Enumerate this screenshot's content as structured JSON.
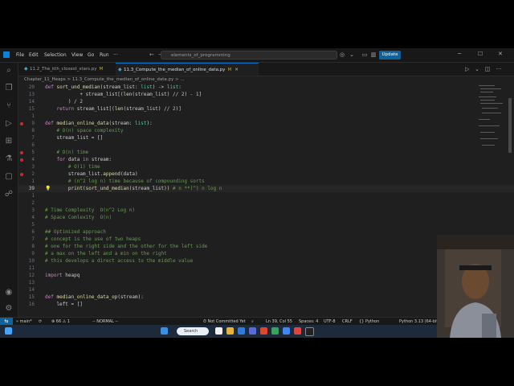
{
  "menu": [
    "File",
    "Edit",
    "Selection",
    "View",
    "Go",
    "Run"
  ],
  "command_center": "elements_of_programming",
  "update_label": "Update",
  "tabs": [
    {
      "label": "11.2_The_kth_closest_stars.py",
      "modified": "M",
      "active": false
    },
    {
      "label": "11.3_Compute_the_median_of_online_data.py",
      "modified": "M",
      "active": true
    }
  ],
  "breadcrumb": "Chapter_11_Heaps > 11.3_Compute_the_median_of_online_data.py > ...",
  "code_lines": [
    {
      "num": "20",
      "text": "def sort_und_median(stream_list: list) -> list:"
    },
    {
      "num": "13",
      "text": "            + stream_list[(len(stream_list) // 2) - 1]"
    },
    {
      "num": "14",
      "text": "        ) / 2"
    },
    {
      "num": "15",
      "text": "    return stream_list[(len(stream_list) // 2)]"
    },
    {
      "num": "1",
      "text": ""
    },
    {
      "num": "9",
      "text": "def median_online_data(stream: list):"
    },
    {
      "num": "8",
      "text": "    # O(n) space complexity"
    },
    {
      "num": "7",
      "text": "    stream_list = []"
    },
    {
      "num": "6",
      "text": ""
    },
    {
      "num": "5",
      "text": "    # O(n) time"
    },
    {
      "num": "4",
      "text": "    for data in stream:"
    },
    {
      "num": "3",
      "text": "        # O(1) time"
    },
    {
      "num": "2",
      "text": "        stream_list.append(data)"
    },
    {
      "num": "1",
      "text": "        # (n^2 log n) time because of compounding sorts"
    },
    {
      "num": "39",
      "text": "        print(sort_und_median(stream_list)) # n **(^) n log n"
    },
    {
      "num": "1",
      "text": ""
    },
    {
      "num": "2",
      "text": ""
    },
    {
      "num": "3",
      "text": "# Time Complexity  O(n^2 Log n)"
    },
    {
      "num": "4",
      "text": "# Space Comlexity  O(n)"
    },
    {
      "num": "5",
      "text": ""
    },
    {
      "num": "6",
      "text": "## Optimized approach"
    },
    {
      "num": "7",
      "text": "# concept is the use of two heaps"
    },
    {
      "num": "8",
      "text": "# one for the right side and the other for the left side"
    },
    {
      "num": "9",
      "text": "# a max on the left and a min on the right"
    },
    {
      "num": "10",
      "text": "# this develops a direct access to the middle value"
    },
    {
      "num": "11",
      "text": ""
    },
    {
      "num": "12",
      "text": "import heapq"
    },
    {
      "num": "13",
      "text": ""
    },
    {
      "num": "14",
      "text": ""
    },
    {
      "num": "15",
      "text": "def median_online_data_op(stream):"
    },
    {
      "num": "16",
      "text": "    left = []"
    }
  ],
  "status": {
    "branch": "main*",
    "sync": "⟳",
    "errors": "66",
    "warnings": "1",
    "mode": "-- NORMAL --",
    "commit": "Not Committed Yet",
    "position": "Ln 39, Col 55",
    "spaces": "Spaces: 4",
    "encoding": "UTF-8",
    "eol": "CRLF",
    "language": "{} Python",
    "interpreter": "Python 3.13 (64-bit)"
  },
  "taskbar": {
    "search_label": "Search"
  },
  "colors": {
    "accent": "#0078d4",
    "breakpoint": "#c72e2e",
    "update": "#0e639c"
  }
}
